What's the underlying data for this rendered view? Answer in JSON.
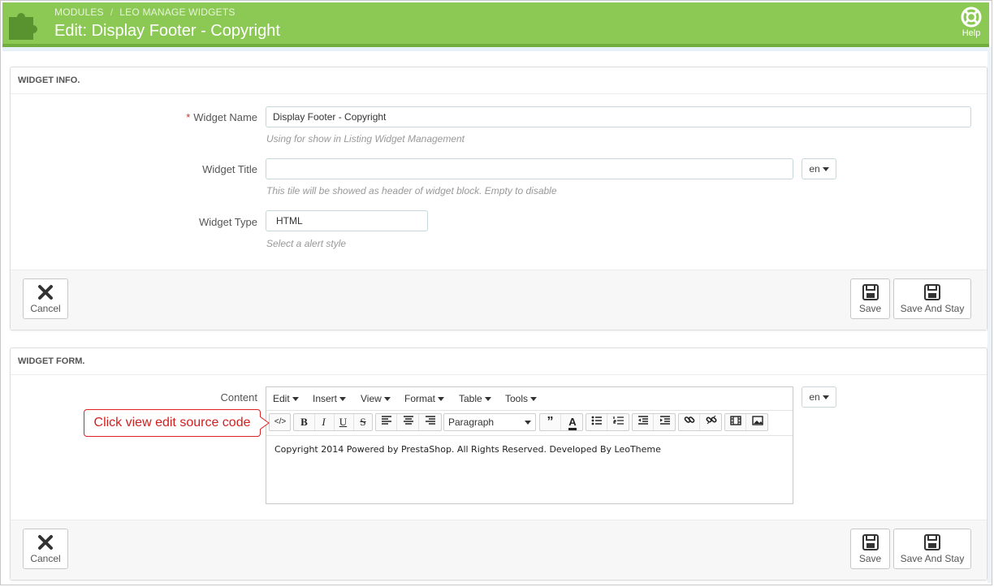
{
  "header": {
    "breadcrumb": [
      "MODULES",
      "LEO MANAGE WIDGETS"
    ],
    "title": "Edit: Display Footer - Copyright",
    "help_label": "Help"
  },
  "widget_info": {
    "heading": "WIDGET INFO.",
    "name_label": "Widget Name",
    "required_mark": "*",
    "name_value": "Display Footer - Copyright",
    "name_help": "Using for show in Listing Widget Management",
    "title_label": "Widget Title",
    "title_value": "",
    "title_help": "This tile will be showed as header of widget block. Empty to disable",
    "lang": "en",
    "type_label": "Widget Type",
    "type_value": "HTML",
    "type_help": "Select a alert style"
  },
  "widget_form": {
    "heading": "WIDGET FORM.",
    "content_label": "Content",
    "lang": "en",
    "menus": [
      "Edit",
      "Insert",
      "View",
      "Format",
      "Table",
      "Tools"
    ],
    "format_select": "Paragraph",
    "content_text": "Copyright 2014 Powered by PrestaShop. All Rights Reserved. Developed By LeoTheme"
  },
  "buttons": {
    "cancel": "Cancel",
    "save": "Save",
    "save_and_stay": "Save And Stay"
  },
  "callout": "Click view edit source code",
  "colors": {
    "header_green": "#8bc954",
    "callout_red": "#d21f1f"
  }
}
